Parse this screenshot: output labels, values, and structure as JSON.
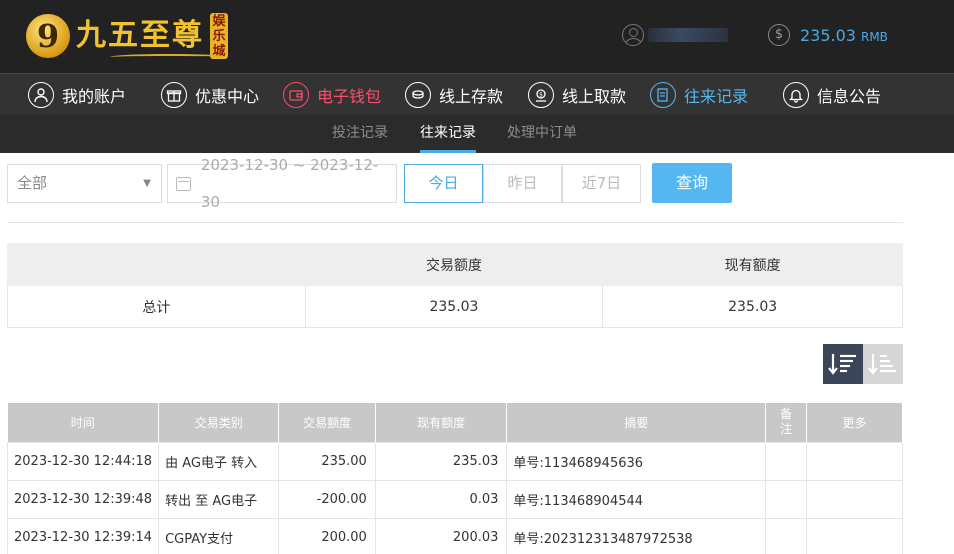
{
  "brand": {
    "mark": "9",
    "name": "九五至尊",
    "tag": "娱乐城"
  },
  "header": {
    "balance": "235.03",
    "balance_unit": "RMB",
    "currency_symbol": "$"
  },
  "nav": {
    "items": [
      {
        "label": "我的账户",
        "icon": "user-icon"
      },
      {
        "label": "优惠中心",
        "icon": "gift-icon"
      },
      {
        "label": "电子钱包",
        "icon": "wallet-icon"
      },
      {
        "label": "线上存款",
        "icon": "deposit-icon"
      },
      {
        "label": "线上取款",
        "icon": "withdraw-icon"
      },
      {
        "label": "往来记录",
        "icon": "records-icon"
      },
      {
        "label": "信息公告",
        "icon": "bell-icon"
      }
    ]
  },
  "subnav": {
    "items": [
      {
        "label": "投注记录"
      },
      {
        "label": "往来记录"
      },
      {
        "label": "处理中订单"
      }
    ]
  },
  "filter": {
    "type_value": "全部",
    "date_range": "2023-12-30 ~ 2023-12-30",
    "today": "今日",
    "yesterday": "昨日",
    "last7": "近7日",
    "query": "查询"
  },
  "summary": {
    "col_amount": "交易额度",
    "col_balance": "现有额度",
    "row_label": "总计",
    "amount": "235.03",
    "balance": "235.03"
  },
  "records": {
    "headers": {
      "time": "时间",
      "type": "交易类别",
      "amount": "交易额度",
      "balance": "现有额度",
      "summary": "摘要",
      "note": "备注",
      "more": "更多"
    },
    "rows": [
      {
        "time": "2023-12-30 12:44:18",
        "type": "由 AG电子 转入",
        "amount": "235.00",
        "balance": "235.03",
        "summary": "单号:113468945636"
      },
      {
        "time": "2023-12-30 12:39:48",
        "type": "转出 至 AG电子",
        "amount": "-200.00",
        "balance": "0.03",
        "summary": "单号:113468904544"
      },
      {
        "time": "2023-12-30 12:39:14",
        "type": "CGPAY支付",
        "amount": "200.00",
        "balance": "200.03",
        "summary": "单号:202312313487972538"
      }
    ]
  },
  "colors": {
    "accent_blue": "#4aa9e6",
    "wallet_red": "#ff4d6a",
    "header_bg": "#222222",
    "nav_bg": "#333333"
  }
}
